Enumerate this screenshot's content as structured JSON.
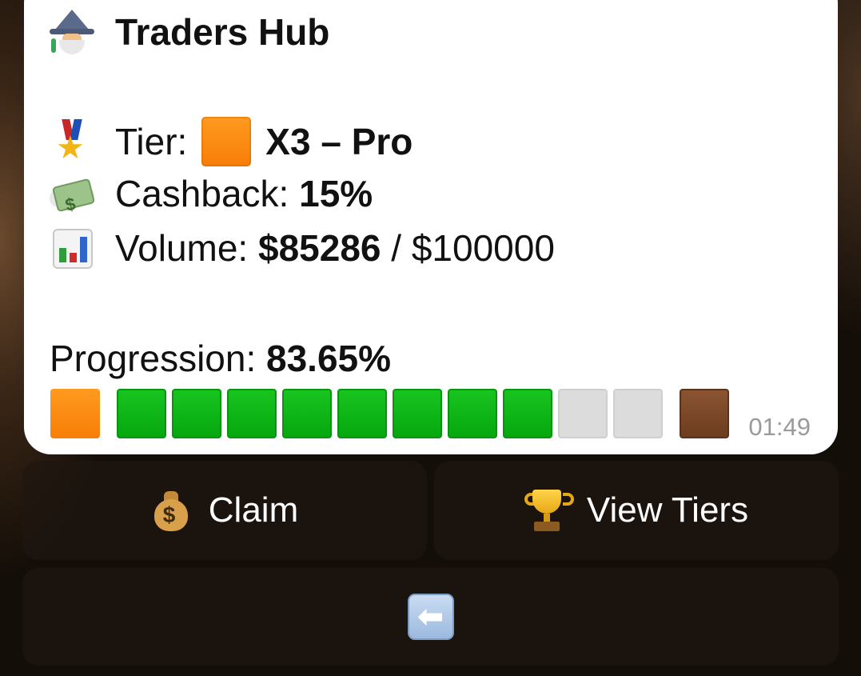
{
  "message": {
    "title": "Traders Hub",
    "title_icon": "mage-icon",
    "tier": {
      "icon": "military-medal-icon",
      "label": "Tier:",
      "badge_color": "#f7830b",
      "value": "X3 – Pro"
    },
    "cashback": {
      "icon": "money-with-wings-icon",
      "label": "Cashback:",
      "value": "15%"
    },
    "volume": {
      "icon": "bar-chart-icon",
      "label": "Volume:",
      "current": "$85286",
      "separator": "/",
      "target": "$100000"
    },
    "progression": {
      "label": "Progression:",
      "value": "83.65%",
      "current_tier_color": "#f7830b",
      "filled_segments": 8,
      "total_segments": 10,
      "filled_color": "#0fb816",
      "empty_color": "#dcdcdc",
      "next_tier_color": "#7a4628"
    },
    "time": "01:49"
  },
  "keyboard": {
    "claim": {
      "icon": "money-bag-icon",
      "label": "Claim"
    },
    "view_tiers": {
      "icon": "trophy-icon",
      "label": "View Tiers"
    },
    "back": {
      "icon": "left-arrow-icon",
      "glyph": "⬅"
    }
  }
}
